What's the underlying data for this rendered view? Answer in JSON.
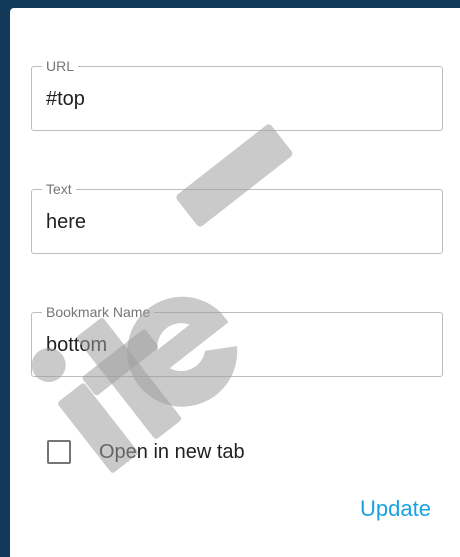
{
  "url_field": {
    "label": "URL",
    "value": "#top"
  },
  "text_field": {
    "label": "Text",
    "value": "here"
  },
  "bookmark_field": {
    "label": "Bookmark Name",
    "value": "bottom"
  },
  "new_tab": {
    "label": "Open in new tab",
    "checked": false
  },
  "actions": {
    "update_label": "Update"
  },
  "colors": {
    "accent": "#1ba1e2",
    "backdrop": "#12385a",
    "watermark": "#9e9e9e"
  }
}
